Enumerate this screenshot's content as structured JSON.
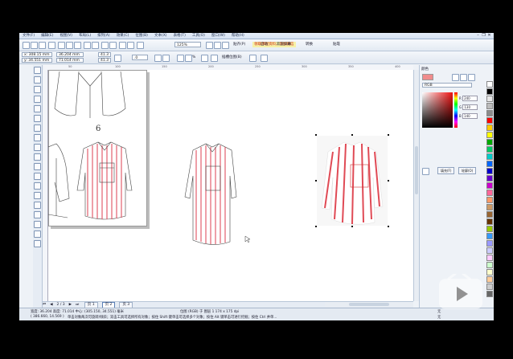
{
  "menu": {
    "items": [
      "文件(F)",
      "编辑(E)",
      "视图(V)",
      "布局(L)",
      "排列(A)",
      "效果(C)",
      "位图(B)",
      "文本(X)",
      "表格(T)",
      "工具(O)",
      "窗口(W)",
      "帮助(H)"
    ]
  },
  "toolbar": {
    "zoom_value": "125%",
    "snap_label": "贴齐(P)",
    "launch_label": "启动",
    "welcome_label": "欢迎屏幕",
    "transform_label": "转换",
    "position_label": "贴靠",
    "overlay_hint": "领取课程资料，添加微信",
    "docker_btn_label": "运行",
    "x_value": "x: 308.15 mm",
    "y_value": "y: 34.551 mm",
    "w_value": "36.204 mm",
    "h_value": "71.014 mm",
    "scale_w": "41.3",
    "scale_h": "41.3",
    "angle_value": ".0",
    "percent_label": "%",
    "align_label": "插槽位图(B)"
  },
  "canvas": {
    "page_number": "6"
  },
  "rulers": {
    "h_ticks": [
      "50",
      "100",
      "150",
      "200",
      "250",
      "300",
      "350",
      "400"
    ]
  },
  "pagetabs": {
    "counter": "2 / 3",
    "tabs": [
      "页 1",
      "页 2",
      "页 3"
    ]
  },
  "status": {
    "line1": "宽度: 36.204  高度: 71.014  中心: (305.150, 34.551) 毫米",
    "line1_mid": "位图 (RGB) 于 图层 1 174 x 175 dpi",
    "line2": "( 386.660, 14.569 )",
    "line2_hint": "单击对象两次可旋转/倾斜；双击工具可选择所有对象；按住 Shift 键单击可选择多个对象；按住 Alt 键单击可进行挖掘；按住 Ctrl 并单...",
    "fill_label": "无",
    "outline_label": "无"
  },
  "docker": {
    "title": "颜色",
    "model": "RGB",
    "r_label": "R",
    "g_label": "G",
    "b_label": "B",
    "r": "240",
    "g": "130",
    "b": "140",
    "fill_btn": "填充(F)",
    "outline_btn": "轮廓(O)"
  },
  "palette_colors": [
    "#ffffff",
    "#000000",
    "#e7e7e7",
    "#bcbcbc",
    "#8c8c8c",
    "#ff0000",
    "#ffcc00",
    "#ffff00",
    "#00aa00",
    "#00cc66",
    "#00cccc",
    "#0066ff",
    "#0000cc",
    "#6600cc",
    "#cc00cc",
    "#ff6699",
    "#ff9966",
    "#cc9966",
    "#996633",
    "#663300",
    "#99cc00",
    "#3399ff",
    "#9999ff",
    "#ccccff",
    "#ffccff",
    "#ccffcc",
    "#ffffcc",
    "#ffcc99",
    "#cccccc",
    "#666666"
  ],
  "accent": "#e05060"
}
